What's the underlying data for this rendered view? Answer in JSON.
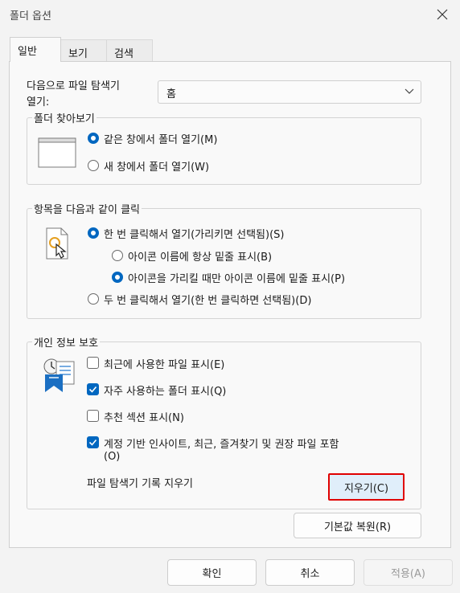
{
  "window": {
    "title": "폴더 옵션"
  },
  "tabs": [
    {
      "label": "일반"
    },
    {
      "label": "보기"
    },
    {
      "label": "검색"
    }
  ],
  "open_explorer": {
    "label_line1": "다음으로 파일 탐색기",
    "label_line2": "열기:",
    "value": "홈"
  },
  "browse_folders": {
    "title": "폴더 찾아보기",
    "options": [
      {
        "label": "같은 창에서 폴더 열기(M)",
        "selected": true
      },
      {
        "label": "새 창에서 폴더 열기(W)",
        "selected": false
      }
    ]
  },
  "click_items": {
    "title": "항목을 다음과 같이 클릭",
    "options": [
      {
        "label": "한 번 클릭해서 열기(가리키면 선택됨)(S)",
        "selected": true
      },
      {
        "label": "아이콘 이름에 항상 밑줄 표시(B)",
        "selected": false
      },
      {
        "label": "아이콘을 가리킬 때만 아이콘 이름에 밑줄 표시(P)",
        "selected": true
      },
      {
        "label": "두 번 클릭해서 열기(한 번 클릭하면 선택됨)(D)",
        "selected": false
      }
    ]
  },
  "privacy": {
    "title": "개인 정보 보호",
    "checks": [
      {
        "label": "최근에 사용한 파일 표시(E)",
        "checked": false
      },
      {
        "label": "자주 사용하는 폴더 표시(Q)",
        "checked": true
      },
      {
        "label": "추천 섹션 표시(N)",
        "checked": false
      },
      {
        "label_line1": "계정 기반 인사이트, 최근, 즐겨찾기 및 권장 파일 포함",
        "label_line2": "(O)",
        "checked": true
      }
    ],
    "clear_history_label": "파일 탐색기 기록 지우기",
    "clear_button": "지우기(C)"
  },
  "restore_defaults_button": "기본값 복원(R)",
  "footer": {
    "ok": "확인",
    "cancel": "취소",
    "apply": "적용(A)"
  },
  "colors": {
    "accent": "#0067c0",
    "highlight": "#e00000"
  }
}
